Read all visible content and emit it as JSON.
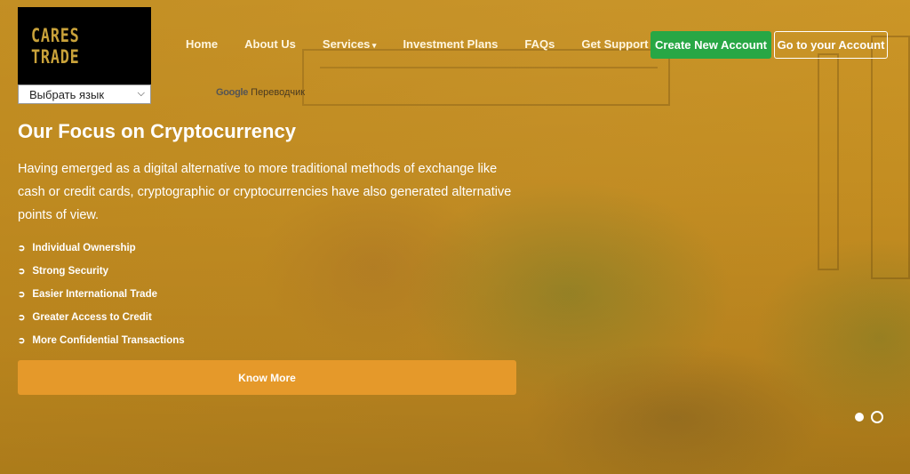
{
  "brand": {
    "logo_text": "CARES TRADE"
  },
  "language_select": {
    "value": "Выбрать язык",
    "powered_by_brand": "Google",
    "powered_by_text": "Переводчик"
  },
  "nav": {
    "items": [
      {
        "label": "Home"
      },
      {
        "label": "About Us"
      },
      {
        "label": "Services"
      },
      {
        "label": "Investment Plans"
      },
      {
        "label": "FAQs"
      },
      {
        "label": "Get Support"
      }
    ],
    "create_account": "Create New Account",
    "go_to_account": "Go to your Account"
  },
  "hero": {
    "title": "Our Focus on Cryptocurrency",
    "description": "Having emerged as a digital alternative to more traditional methods of exchange like cash or credit cards, cryptographic or cryptocurrencies have also generated alternative points of view.",
    "features": [
      "Individual Ownership",
      "Strong Security",
      "Easier International Trade",
      "Greater Access to Credit",
      "More Confidential Transactions"
    ],
    "cta": "Know More"
  },
  "slider": {
    "count": 2,
    "active_index": 0
  },
  "colors": {
    "primary_green": "#28a745",
    "accent_orange": "#e5992a",
    "logo_gold": "#c9a23a"
  }
}
